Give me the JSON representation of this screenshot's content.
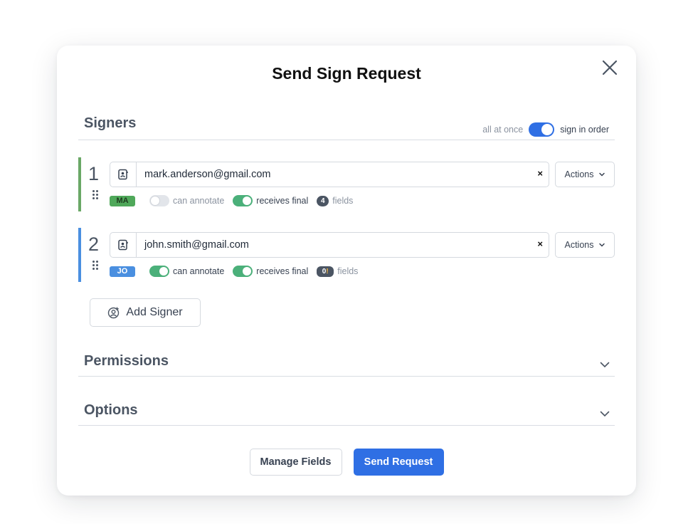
{
  "modal": {
    "title": "Send Sign Request"
  },
  "signers_section": {
    "title": "Signers",
    "toggle_left_label": "all at once",
    "toggle_right_label": "sign in order",
    "sign_in_order": true
  },
  "signers": [
    {
      "number": "1",
      "email": "mark.anderson@gmail.com",
      "initials": "MA",
      "color": "#4fa85a",
      "can_annotate": false,
      "can_annotate_label": "can annotate",
      "receives_final": true,
      "receives_final_label": "receives final",
      "field_count": "4",
      "fields_label": "fields",
      "actions_label": "Actions"
    },
    {
      "number": "2",
      "email": "john.smith@gmail.com",
      "initials": "JO",
      "color": "#4a8fe0",
      "can_annotate": true,
      "can_annotate_label": "can annotate",
      "receives_final": true,
      "receives_final_label": "receives final",
      "field_count": "0",
      "field_warning": "!",
      "fields_label": "fields",
      "actions_label": "Actions"
    }
  ],
  "add_signer_label": "Add Signer",
  "permissions": {
    "title": "Permissions"
  },
  "options": {
    "title": "Options"
  },
  "footer": {
    "manage_fields_label": "Manage Fields",
    "send_request_label": "Send Request"
  },
  "icons": {
    "close": "close-icon",
    "contact": "contact-book-icon",
    "chevron": "chevron-down-icon",
    "add_user": "add-user-icon",
    "drag": "drag-handle-icon"
  },
  "colors": {
    "primary": "#2f6fe4",
    "toggle_on": "#4bb07a"
  }
}
